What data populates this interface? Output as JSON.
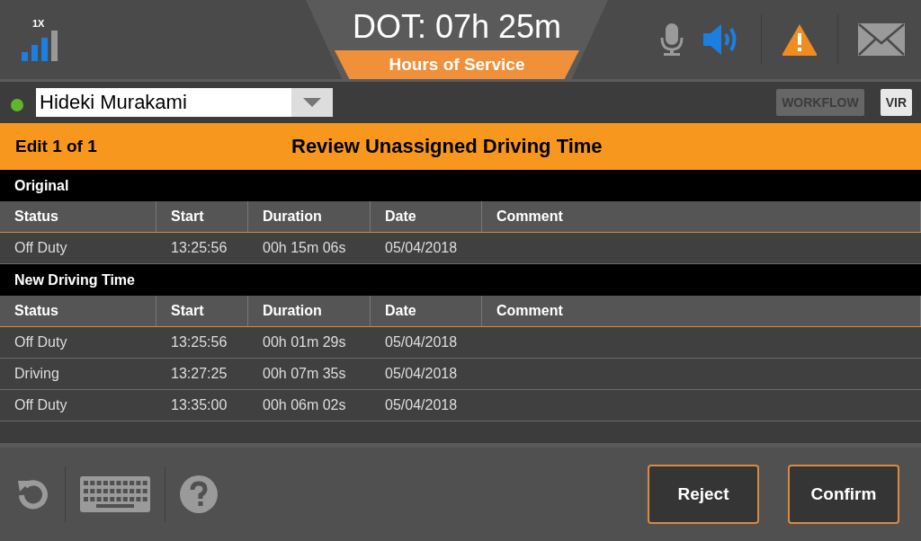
{
  "header": {
    "signal_label": "1X",
    "dot_clock": "DOT: 07h 25m",
    "tab_label": "Hours of Service"
  },
  "driver": {
    "name": "Hideki Murakami",
    "online": true
  },
  "top_buttons": [
    {
      "label": "WORKFLOW",
      "disabled": true
    },
    {
      "label": "VIR",
      "disabled": false
    }
  ],
  "title_bar": {
    "counter": "Edit 1 of 1",
    "title": "Review Unassigned Driving Time"
  },
  "sections": [
    {
      "title": "Original",
      "columns": [
        "Status",
        "Start",
        "Duration",
        "Date",
        "Comment"
      ],
      "rows": [
        [
          "Off Duty",
          "13:25:56",
          "00h 15m 06s",
          "05/04/2018"
        ]
      ]
    },
    {
      "title": "New Driving Time",
      "columns": [
        "Status",
        "Start",
        "Duration",
        "Date",
        "Comment"
      ],
      "rows": [
        [
          "Off Duty",
          "13:25:56",
          "00h 01m 29s",
          "05/04/2018"
        ],
        [
          "Driving",
          "13:27:25",
          "00h 07m 35s",
          "05/04/2018"
        ],
        [
          "Off Duty",
          "13:35:00",
          "00h 06m 02s",
          "05/04/2018"
        ]
      ]
    }
  ],
  "actions": [
    "Reject",
    "Confirm"
  ]
}
